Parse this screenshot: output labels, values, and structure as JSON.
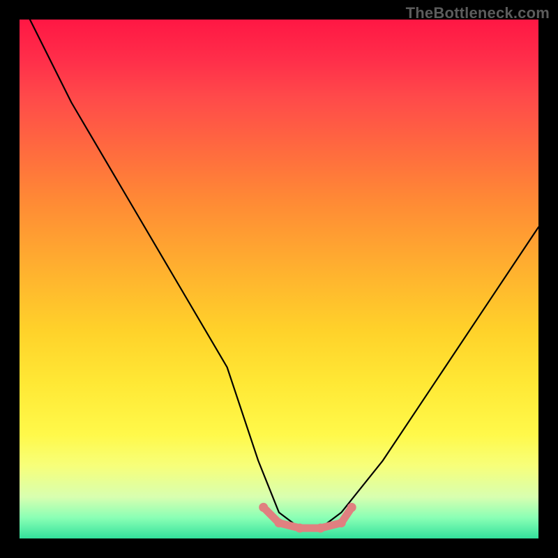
{
  "watermark": {
    "text": "TheBottleneck.com"
  },
  "chart_data": {
    "type": "line",
    "title": "",
    "xlabel": "",
    "ylabel": "",
    "x_range": [
      0,
      100
    ],
    "y_range": [
      0,
      100
    ],
    "series": [
      {
        "name": "bottleneck-curve",
        "color": "#000000",
        "x": [
          2,
          10,
          20,
          30,
          40,
          46,
          50,
          54,
          58,
          62,
          70,
          80,
          90,
          100
        ],
        "values": [
          100,
          84,
          67,
          50,
          33,
          15,
          5,
          2,
          2,
          5,
          15,
          30,
          45,
          60
        ]
      },
      {
        "name": "optimal-range-highlight",
        "color": "#e57373",
        "x": [
          47,
          50,
          54,
          58,
          62,
          64
        ],
        "values": [
          6,
          3,
          2,
          2,
          3,
          6
        ]
      }
    ],
    "annotations": [],
    "legend": false,
    "grid": false
  },
  "gradient": {
    "stops": [
      {
        "pct": 0,
        "color": "#ff1744"
      },
      {
        "pct": 15,
        "color": "#ff4a4a"
      },
      {
        "pct": 35,
        "color": "#ff8a35"
      },
      {
        "pct": 60,
        "color": "#ffd22a"
      },
      {
        "pct": 80,
        "color": "#fff94a"
      },
      {
        "pct": 96,
        "color": "#8affb5"
      },
      {
        "pct": 100,
        "color": "#33e19c"
      }
    ]
  }
}
